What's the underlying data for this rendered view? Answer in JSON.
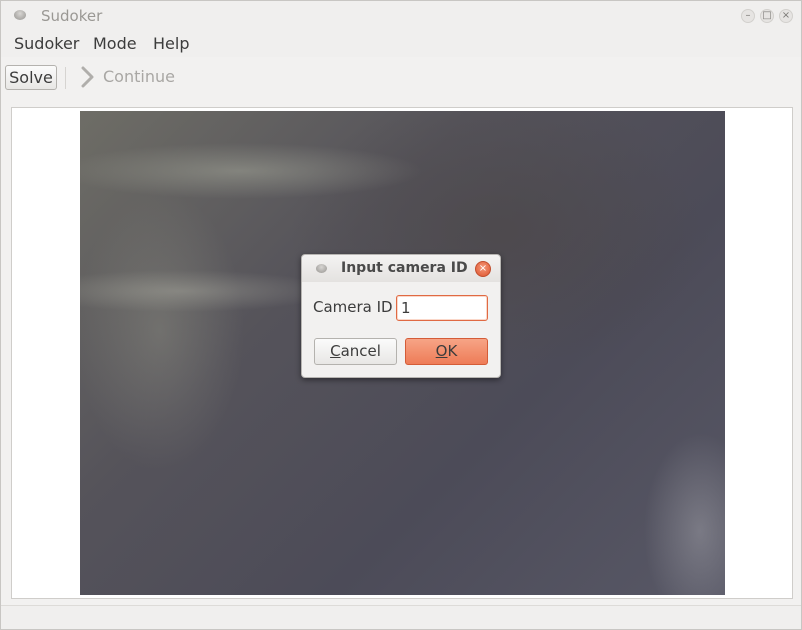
{
  "window": {
    "title": "Sudoker",
    "controls": {
      "minimize": "–",
      "maximize": "□",
      "close": "×"
    }
  },
  "menubar": {
    "items": [
      {
        "label": "Sudoker"
      },
      {
        "label": "Mode"
      },
      {
        "label": "Help"
      }
    ]
  },
  "toolbar": {
    "solve_label": "Solve",
    "continue_label": "Continue",
    "continue_icon": "chevron-right-icon"
  },
  "dialog": {
    "title": "Input camera ID",
    "field_label": "Camera ID",
    "field_value": "1",
    "cancel_label": {
      "mnemonic": "C",
      "rest": "ancel"
    },
    "ok_label": {
      "mnemonic": "O",
      "rest": "K"
    },
    "close_symbol": "×",
    "accent_color": "#ee7c57"
  }
}
